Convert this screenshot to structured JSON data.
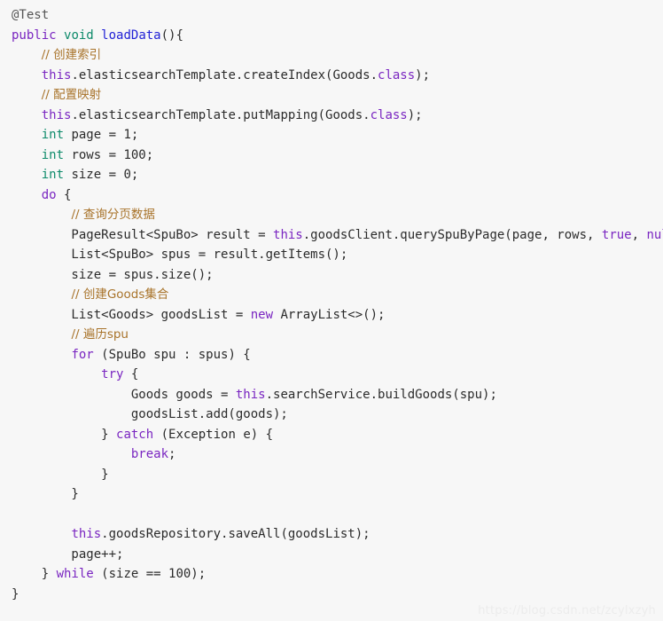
{
  "document": {
    "type": "source-code-listing",
    "language": "Java",
    "background_color": "#f7f7f7",
    "colors": {
      "keyword": "#7a26c1",
      "type": "#0d8a6a",
      "method": "#2121d6",
      "comment": "#a8732a",
      "annotation": "#555555",
      "plain": "#2b2b2b",
      "watermark": "#ececec"
    }
  },
  "watermark": {
    "text": "https://blog.csdn.net/zcylxzyh"
  },
  "code": {
    "lines": [
      [
        {
          "t": "@Test",
          "c": "anno"
        }
      ],
      [
        {
          "t": "public",
          "c": "kw"
        },
        {
          "t": " ",
          "c": "plain"
        },
        {
          "t": "void",
          "c": "type"
        },
        {
          "t": " ",
          "c": "plain"
        },
        {
          "t": "loadData",
          "c": "fn"
        },
        {
          "t": "(){",
          "c": "plain"
        }
      ],
      [
        {
          "t": "    ",
          "c": "plain"
        },
        {
          "t": "// 创建索引",
          "c": "cmt"
        }
      ],
      [
        {
          "t": "    ",
          "c": "plain"
        },
        {
          "t": "this",
          "c": "kw"
        },
        {
          "t": ".elasticsearchTemplate.createIndex(Goods.",
          "c": "plain"
        },
        {
          "t": "class",
          "c": "kw"
        },
        {
          "t": ");",
          "c": "plain"
        }
      ],
      [
        {
          "t": "    ",
          "c": "plain"
        },
        {
          "t": "// 配置映射",
          "c": "cmt"
        }
      ],
      [
        {
          "t": "    ",
          "c": "plain"
        },
        {
          "t": "this",
          "c": "kw"
        },
        {
          "t": ".elasticsearchTemplate.putMapping(Goods.",
          "c": "plain"
        },
        {
          "t": "class",
          "c": "kw"
        },
        {
          "t": ");",
          "c": "plain"
        }
      ],
      [
        {
          "t": "    ",
          "c": "plain"
        },
        {
          "t": "int",
          "c": "type"
        },
        {
          "t": " page = 1;",
          "c": "plain"
        }
      ],
      [
        {
          "t": "    ",
          "c": "plain"
        },
        {
          "t": "int",
          "c": "type"
        },
        {
          "t": " rows = 100;",
          "c": "plain"
        }
      ],
      [
        {
          "t": "    ",
          "c": "plain"
        },
        {
          "t": "int",
          "c": "type"
        },
        {
          "t": " size = 0;",
          "c": "plain"
        }
      ],
      [
        {
          "t": "    ",
          "c": "plain"
        },
        {
          "t": "do",
          "c": "kw"
        },
        {
          "t": " {",
          "c": "plain"
        }
      ],
      [
        {
          "t": "        ",
          "c": "plain"
        },
        {
          "t": "// 查询分页数据",
          "c": "cmt"
        }
      ],
      [
        {
          "t": "        PageResult<SpuBo> result = ",
          "c": "plain"
        },
        {
          "t": "this",
          "c": "kw"
        },
        {
          "t": ".goodsClient.querySpuByPage(page, rows, ",
          "c": "plain"
        },
        {
          "t": "true",
          "c": "kw"
        },
        {
          "t": ", ",
          "c": "plain"
        },
        {
          "t": "null",
          "c": "kw"
        },
        {
          "t": ");",
          "c": "plain"
        }
      ],
      [
        {
          "t": "        List<SpuBo> spus = result.getItems();",
          "c": "plain"
        }
      ],
      [
        {
          "t": "        size = spus.size();",
          "c": "plain"
        }
      ],
      [
        {
          "t": "        ",
          "c": "plain"
        },
        {
          "t": "// 创建Goods集合",
          "c": "cmt"
        }
      ],
      [
        {
          "t": "        List<Goods> goodsList = ",
          "c": "plain"
        },
        {
          "t": "new",
          "c": "kw"
        },
        {
          "t": " ArrayList<>();",
          "c": "plain"
        }
      ],
      [
        {
          "t": "        ",
          "c": "plain"
        },
        {
          "t": "// 遍历spu",
          "c": "cmt"
        }
      ],
      [
        {
          "t": "        ",
          "c": "plain"
        },
        {
          "t": "for",
          "c": "kw"
        },
        {
          "t": " (SpuBo spu : spus) {",
          "c": "plain"
        }
      ],
      [
        {
          "t": "            ",
          "c": "plain"
        },
        {
          "t": "try",
          "c": "kw"
        },
        {
          "t": " {",
          "c": "plain"
        }
      ],
      [
        {
          "t": "                Goods goods = ",
          "c": "plain"
        },
        {
          "t": "this",
          "c": "kw"
        },
        {
          "t": ".searchService.buildGoods(spu);",
          "c": "plain"
        }
      ],
      [
        {
          "t": "                goodsList.add(goods);",
          "c": "plain"
        }
      ],
      [
        {
          "t": "            } ",
          "c": "plain"
        },
        {
          "t": "catch",
          "c": "kw"
        },
        {
          "t": " (Exception e) {",
          "c": "plain"
        }
      ],
      [
        {
          "t": "                ",
          "c": "plain"
        },
        {
          "t": "break",
          "c": "kw"
        },
        {
          "t": ";",
          "c": "plain"
        }
      ],
      [
        {
          "t": "            }",
          "c": "plain"
        }
      ],
      [
        {
          "t": "        }",
          "c": "plain"
        }
      ],
      [],
      [
        {
          "t": "        ",
          "c": "plain"
        },
        {
          "t": "this",
          "c": "kw"
        },
        {
          "t": ".goodsRepository.saveAll(goodsList);",
          "c": "plain"
        }
      ],
      [
        {
          "t": "        page++;",
          "c": "plain"
        }
      ],
      [
        {
          "t": "    } ",
          "c": "plain"
        },
        {
          "t": "while",
          "c": "kw"
        },
        {
          "t": " (size == 100);",
          "c": "plain"
        }
      ],
      [
        {
          "t": "}",
          "c": "plain"
        }
      ]
    ]
  }
}
